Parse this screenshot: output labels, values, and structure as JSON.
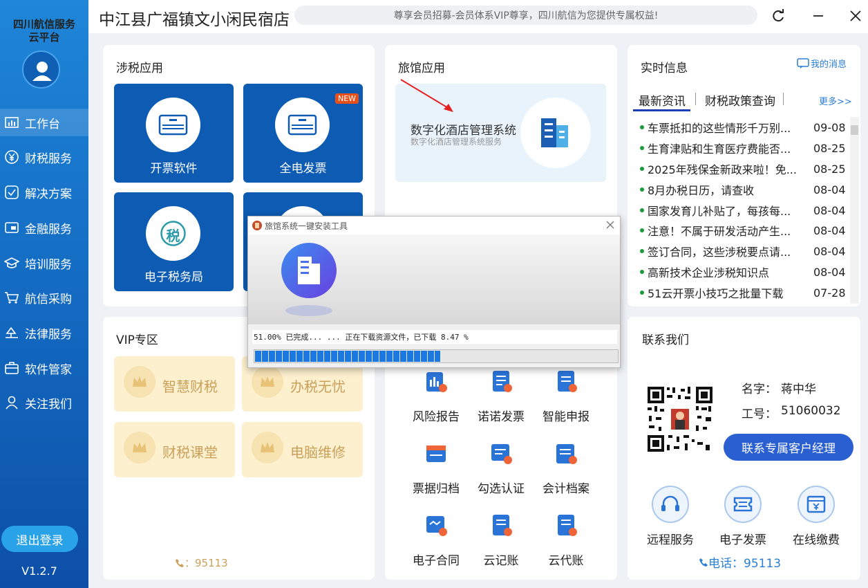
{
  "sidebar": {
    "brand_line1": "四川航信服务",
    "brand_line2": "云平台",
    "items": [
      {
        "label": "工作台",
        "icon": "chart-bar-icon"
      },
      {
        "label": "财税服务",
        "icon": "yen-icon"
      },
      {
        "label": "解决方案",
        "icon": "check-box-icon"
      },
      {
        "label": "金融服务",
        "icon": "card-icon"
      },
      {
        "label": "培训服务",
        "icon": "graduation-cap-icon"
      },
      {
        "label": "航信采购",
        "icon": "cart-icon"
      },
      {
        "label": "法律服务",
        "icon": "scales-icon"
      },
      {
        "label": "软件管家",
        "icon": "toolbox-icon"
      },
      {
        "label": "关注我们",
        "icon": "user-icon"
      }
    ],
    "logout": "退出登录",
    "version": "V1.2.7"
  },
  "header": {
    "shop_name": "中江县广福镇文小闲民宿店",
    "notice": "尊享会员招募-会员体系VIP尊享，四川航信为您提供专属权益!"
  },
  "tax_apps": {
    "title": "涉税应用",
    "tiles": [
      {
        "label": "开票软件"
      },
      {
        "label": "全电发票",
        "badge": "NEW"
      },
      {
        "label": "电子税务局",
        "glyph": "税"
      }
    ]
  },
  "hotel_apps": {
    "title": "旅馆应用",
    "app_name": "数字化酒店管理系统",
    "app_sub": "数字化酒店管理系统服务"
  },
  "realtime": {
    "title": "实时信息",
    "my_messages": "我的消息",
    "tab_news": "最新资讯",
    "tab_policy": "财税政策查询",
    "more": "更多>>",
    "news": [
      {
        "title": "车票抵扣的这些情形千万别...",
        "date": "09-08"
      },
      {
        "title": "生育津贴和生育医疗费能否...",
        "date": "08-25"
      },
      {
        "title": "2025年残保金新政来啦！免...",
        "date": "08-25"
      },
      {
        "title": "8月办税日历，请查收",
        "date": "08-04"
      },
      {
        "title": "国家发育儿补贴了，每孩每...",
        "date": "08-04"
      },
      {
        "title": "注意！不属于研发活动产生...",
        "date": "08-04"
      },
      {
        "title": "签订合同，这些涉税要点请...",
        "date": "08-04"
      },
      {
        "title": "高新技术企业涉税知识点",
        "date": "08-04"
      },
      {
        "title": "51云开票小技巧之批量下载",
        "date": "07-28"
      }
    ]
  },
  "vip": {
    "title": "VIP专区",
    "items": [
      "智慧财税",
      "办税无忧",
      "财税课堂",
      "电脑维修"
    ],
    "phone": "：95113"
  },
  "services": {
    "items": [
      "风险报告",
      "诺诺发票",
      "智能申报",
      "票据归档",
      "勾选认证",
      "会计档案",
      "电子合同",
      "云记账",
      "云代账"
    ]
  },
  "contact": {
    "title": "联系我们",
    "name_label": "名字：",
    "name_value": "蒋中华",
    "id_label": "工号：",
    "id_value": "51060032",
    "manager_button": "联系专属客户经理",
    "services": [
      "远程服务",
      "电子发票",
      "在线缴费"
    ],
    "phone": "电话：95113"
  },
  "dialog": {
    "title": "旅馆系统一键安装工具",
    "status": "51.00% 已完成... ...  正在下载资源文件，已下载 8.47 %",
    "progress": 0.51
  },
  "colors": {
    "sidebar": "#1570c6",
    "tile": "#0d5bb2",
    "accent": "#2a5fd1",
    "vip_bg": "#fdf0cf"
  }
}
